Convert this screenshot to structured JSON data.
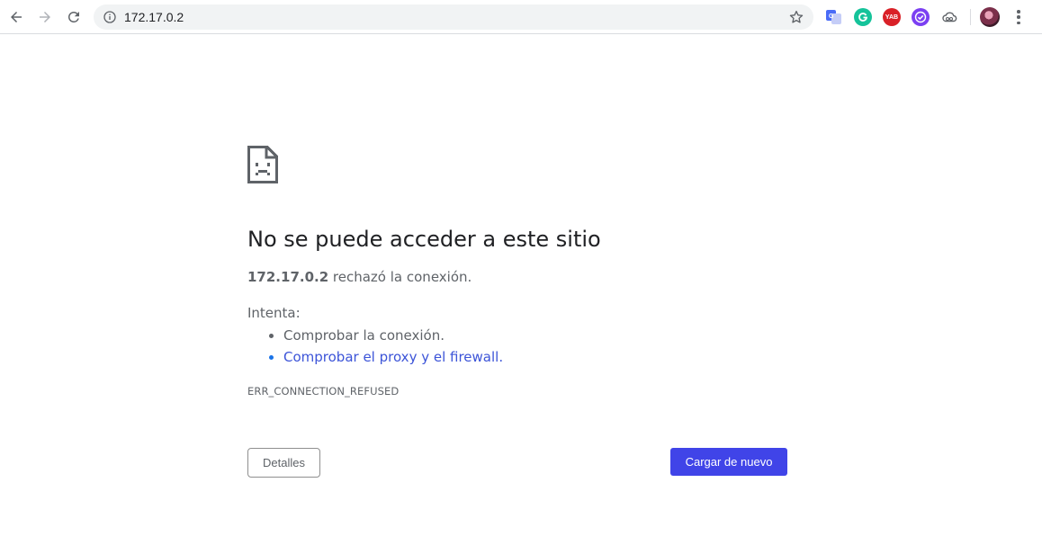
{
  "browser": {
    "url": "172.17.0.2",
    "extensions": [
      {
        "name": "translate-extension-icon",
        "label": "",
        "color": "#4a6cf7"
      },
      {
        "name": "grammarly-extension-icon",
        "label": "",
        "color": "#15c39a"
      },
      {
        "name": "yab-extension-icon",
        "label": "YAB",
        "color": "#d92027"
      },
      {
        "name": "checkmark-extension-icon",
        "label": "",
        "color": "#7b3ff2"
      },
      {
        "name": "cloud-extension-icon",
        "label": "",
        "color": "#5f6368"
      }
    ]
  },
  "error": {
    "title": "No se puede acceder a este sitio",
    "host": "172.17.0.2",
    "message_suffix": " rechazó la conexión.",
    "try_label": "Intenta:",
    "suggestions": [
      "Comprobar la conexión.",
      "Comprobar el proxy y el firewall",
      "."
    ],
    "code": "ERR_CONNECTION_REFUSED",
    "details_label": "Detalles",
    "reload_label": "Cargar de nuevo"
  },
  "colors": {
    "accent": "#4044e8",
    "link": "#3c54d8",
    "text_secondary": "#5f6368"
  }
}
